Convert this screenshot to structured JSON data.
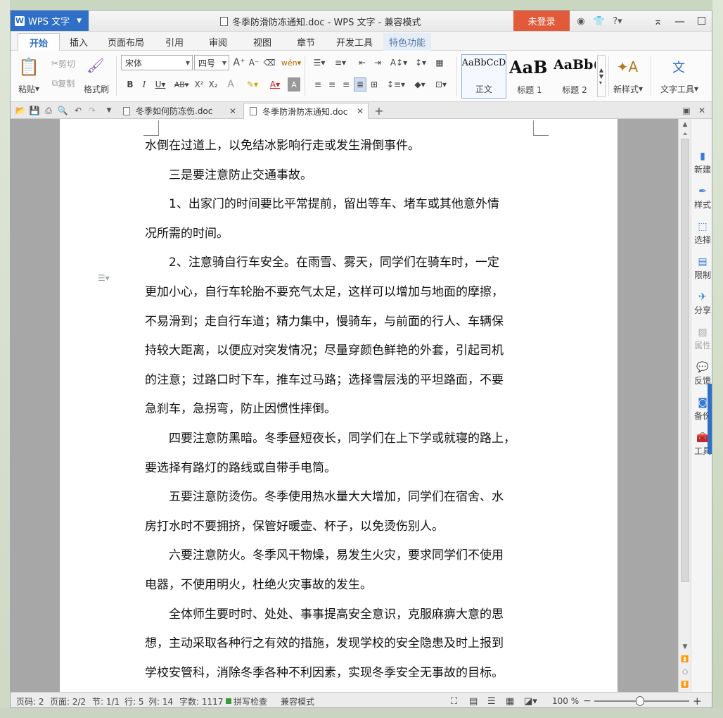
{
  "app": {
    "button_label": "WPS 文字",
    "window_title": "冬季防滑防冻通知.doc - WPS 文字 - 兼容模式",
    "login_label": "未登录"
  },
  "menu_tabs": [
    "开始",
    "插入",
    "页面布局",
    "引用",
    "审阅",
    "视图",
    "章节",
    "开发工具",
    "特色功能"
  ],
  "ribbon": {
    "paste": "粘贴",
    "cut": "剪切",
    "copy": "复制",
    "format_painter": "格式刷",
    "font_name": "宋体",
    "font_size": "四号",
    "styles": [
      {
        "sample": "AaBbCcD",
        "label": "正文"
      },
      {
        "sample": "AaB",
        "label": "标题 1"
      },
      {
        "sample": "AaBb(",
        "label": "标题 2"
      }
    ],
    "new_style": "新样式",
    "text_tools": "文字工具"
  },
  "file_tabs": [
    {
      "label": "冬季如何防冻伤.doc",
      "active": false
    },
    {
      "label": "冬季防滑防冻通知.doc",
      "active": true
    }
  ],
  "document_lines": [
    "水倒在过道上，以免结冰影响行走或发生滑倒事件。",
    "　　三是要注意防止交通事故。",
    "　　1、出家门的时间要比平常提前，留出等车、堵车或其他意外情",
    "况所需的时间。",
    "　　2、注意骑自行车安全。在雨雪、雾天，同学们在骑车时，一定",
    "更加小心，自行车轮胎不要充气太足，这样可以增加与地面的摩擦，",
    "不易滑到；走自行车道；精力集中，慢骑车，与前面的行人、车辆保",
    "持较大距离，以便应对突发情况；尽量穿颜色鲜艳的外套，引起司机",
    "的注意；过路口时下车，推车过马路；选择雪层浅的平坦路面，不要",
    "急刹车，急拐弯，防止因惯性摔倒。",
    "　　四要注意防黑暗。冬季昼短夜长，同学们在上下学或就寝的路上，",
    "要选择有路灯的路线或自带手电筒。",
    "　　五要注意防烫伤。冬季使用热水量大大增加，同学们在宿舍、水",
    "房打水时不要拥挤，保管好暖壶、杯子，以免烫伤别人。",
    "　　六要注意防火。冬季风干物燥，易发生火灾，要求同学们不使用",
    "电器，不使用明火，杜绝火灾事故的发生。",
    "　　全体师生要时时、处处、事事提高安全意识，克服麻痹大意的思",
    "想，主动采取各种行之有效的措施，发现学校的安全隐患及时上报到",
    "学校安管科，消除冬季各种不利因素，实现冬季安全无事故的目标。"
  ],
  "side_panel": [
    "新建",
    "样式",
    "选择",
    "限制",
    "分享",
    "属性",
    "反馈",
    "备份",
    "工具"
  ],
  "status": {
    "page_code": "页码: 2",
    "pages": "页面: 2/2",
    "section": "节: 1/1",
    "row": "行: 5",
    "col": "列: 14",
    "word_count": "字数: 1117",
    "spell_check": "拼写检查",
    "compat_mode": "兼容模式",
    "zoom": "100 %"
  }
}
